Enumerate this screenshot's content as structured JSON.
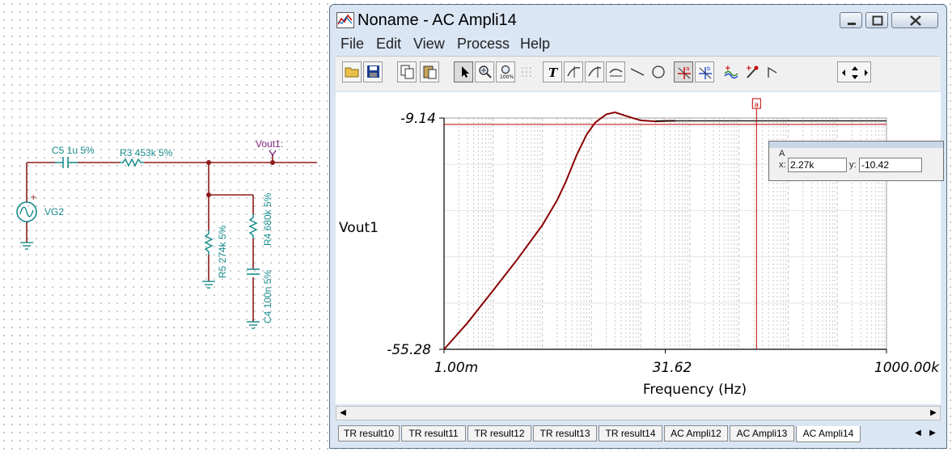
{
  "schematic": {
    "components": {
      "c5": "C5 1u 5%",
      "r3": "R3 453k 5%",
      "vg2": "VG2",
      "vout": "Vout1:",
      "r5": "R5 274k 5%",
      "r4": "R4 680k 5%",
      "c4": "C4 100n 5%"
    }
  },
  "window": {
    "title": "Noname - AC Ampli14",
    "menu": [
      "File",
      "Edit",
      "View",
      "Process",
      "Help"
    ],
    "toolbar_icons": [
      "open-icon",
      "save-icon",
      "copy-icon",
      "paste-icon",
      "pointer-icon",
      "zoom-in-icon",
      "zoom-100-icon",
      "grid-icon",
      "text-icon",
      "cursor-a-icon",
      "cursor-b-icon",
      "curve-icon",
      "line-icon",
      "circle-icon",
      "cursor-a-place-icon",
      "cursor-b-place-icon",
      "add-trace-icon",
      "probe-icon",
      "marker-icon",
      "navigate-icon"
    ],
    "cursor_readout": {
      "name": "A",
      "x_label": "x:",
      "x_value": "2.27k",
      "y_label": "y:",
      "y_value": "-10.42",
      "marker": "a"
    },
    "tabs": [
      "TR result10",
      "TR result11",
      "TR result12",
      "TR result13",
      "TR result14",
      "AC Ampli12",
      "AC Ampli13",
      "AC Ampli14"
    ],
    "active_tab": "AC Ampli14"
  },
  "chart_data": {
    "type": "line",
    "title": "",
    "xlabel": "Frequency (Hz)",
    "ylabel": "Vout1",
    "x_scale": "log",
    "xlim": [
      0.001,
      1000000
    ],
    "ylim": [
      -55.28,
      -9.14
    ],
    "x_tick_labels": [
      "1.00m",
      "31.62",
      "1000.00k"
    ],
    "y_tick_labels": [
      "-9.14",
      "-55.28"
    ],
    "grid": true,
    "cursor": {
      "x": 2270,
      "y": -10.42
    },
    "series": [
      {
        "color": "#8b0000",
        "x": [
          0.001,
          0.003,
          0.01,
          0.03,
          0.1,
          0.2,
          0.3,
          0.5,
          0.8,
          1.2,
          2,
          3,
          5,
          10,
          20,
          35,
          50
        ],
        "y": [
          -55.28,
          -50.0,
          -43.5,
          -37.5,
          -30.5,
          -25.5,
          -21.8,
          -16.5,
          -12.4,
          -10.0,
          -8.4,
          -8.0,
          -8.7,
          -9.6,
          -9.8,
          -9.7,
          -9.7
        ]
      },
      {
        "color": "#000000",
        "x": [
          20,
          1000000
        ],
        "y": [
          -9.7,
          -9.7
        ]
      }
    ],
    "reference_line": {
      "color": "#c00000",
      "y": -10.42
    }
  }
}
